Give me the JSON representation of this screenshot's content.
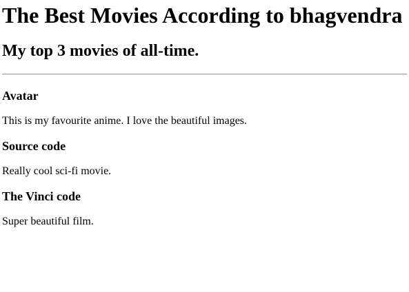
{
  "page": {
    "title": "The Best Movies According to bhagvendra",
    "subtitle": "My top 3 movies of all-time."
  },
  "movies": [
    {
      "title": "Avatar",
      "description": "This is my favourite anime. I love the beautiful images."
    },
    {
      "title": "Source code",
      "description": "Really cool sci-fi movie."
    },
    {
      "title": "The Vinci code",
      "description": "Super beautiful film."
    }
  ]
}
